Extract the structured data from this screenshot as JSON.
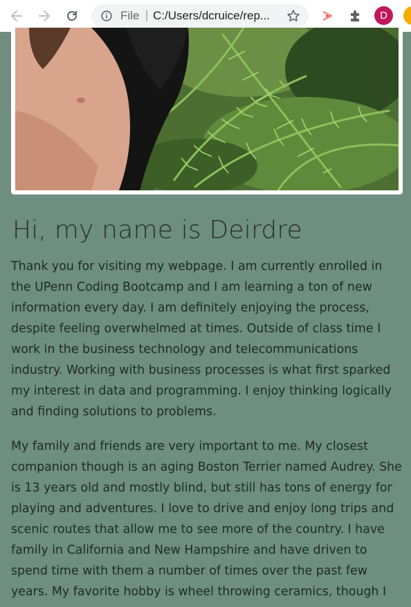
{
  "browser": {
    "file_label": "File",
    "separator": "|",
    "url": "C:/Users/dcruice/rep...",
    "avatar_letter": "D"
  },
  "content": {
    "heading": "Hi, my name is Deirdre",
    "paragraphs": [
      "Thank you for visiting my webpage. I am currently enrolled in the UPenn Coding Bootcamp and I am learning a ton of new information every day. I am definitely enjoying the process, despite feeling overwhelmed at times. Outside of class time I work in the business technology and telecommunications industry. Working with business processes is what first sparked my interest in data and programming. I enjoy thinking logically and finding solutions to problems.",
      "My family and friends are very important to me. My closest companion though is an aging Boston Terrier named Audrey. She is 13 years old and mostly blind, but still has tons of energy for playing and adventures. I love to drive and enjoy long trips and scenic routes that allow me to see more of the country. I have family in California and New Hampshire and have driven to spend time with them a number of times over the past few years. My favorite hobby is wheel throwing ceramics, though I"
    ]
  },
  "icons": {
    "back": "back-arrow-icon",
    "forward": "forward-arrow-icon",
    "reload": "reload-icon",
    "info": "info-icon",
    "bookmark": "star-icon",
    "cast": "cast-extension-icon",
    "extensions": "puzzle-icon"
  },
  "colors": {
    "page_background": "#6e8e80",
    "text": "#1f2a26",
    "avatar": "#c2185b"
  }
}
